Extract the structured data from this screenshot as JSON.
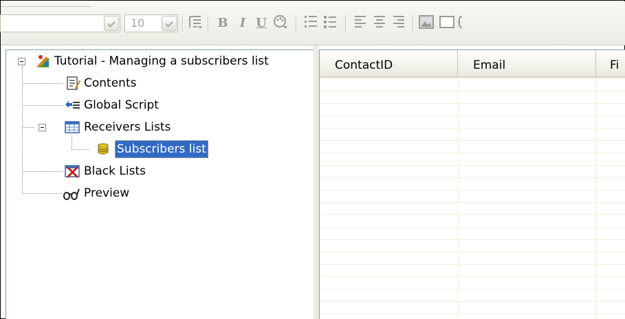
{
  "toolbar": {
    "font_size_value": "10",
    "icons": [
      "indent-icon",
      "bold-icon",
      "italic-icon",
      "underline-icon",
      "font-color-icon",
      "numbered-list-icon",
      "bullet-list-icon",
      "align-left-icon",
      "align-center-icon",
      "align-right-icon",
      "insert-image-icon",
      "insert-frame-icon"
    ],
    "bold_glyph": "B",
    "italic_glyph": "I",
    "underline_glyph": "U"
  },
  "tree": {
    "root_label": "Tutorial - Managing a subscribers list",
    "items": [
      {
        "label": "Contents",
        "icon": "document-edit-icon"
      },
      {
        "label": "Global Script",
        "icon": "script-icon"
      },
      {
        "label": "Receivers Lists",
        "icon": "table-icon"
      },
      {
        "label": "Subscribers list",
        "icon": "database-icon",
        "selected": true
      },
      {
        "label": "Black Lists",
        "icon": "blacklist-icon"
      },
      {
        "label": "Preview",
        "icon": "glasses-icon"
      }
    ]
  },
  "grid": {
    "columns": [
      "ContactID",
      "Email",
      "Fi"
    ]
  },
  "colors": {
    "selection": "#316ac5",
    "toolbar_bg": "#ecebe4",
    "panel_border": "#7f9db9"
  }
}
